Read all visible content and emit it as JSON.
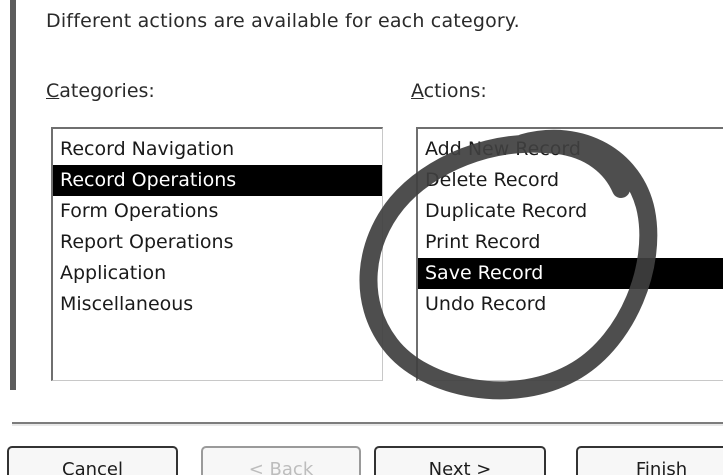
{
  "description": "Different actions are available for each category.",
  "categories": {
    "label_accel": "C",
    "label_rest": "ategories:",
    "items": [
      "Record Navigation",
      "Record Operations",
      "Form Operations",
      "Report Operations",
      "Application",
      "Miscellaneous"
    ],
    "selected": "Record Operations"
  },
  "actions": {
    "label_accel": "A",
    "label_rest": "ctions:",
    "items": [
      "Add New Record",
      "Delete Record",
      "Duplicate Record",
      "Print Record",
      "Save Record",
      "Undo Record"
    ],
    "selected": "Save Record"
  },
  "buttons": {
    "cancel": "Cancel",
    "back": "< Back",
    "next": "Next >",
    "finish": "Finish"
  },
  "colors": {
    "selection_bg": "#000000",
    "selection_fg": "#ffffff",
    "marker_stroke": "#3f3f3f"
  }
}
